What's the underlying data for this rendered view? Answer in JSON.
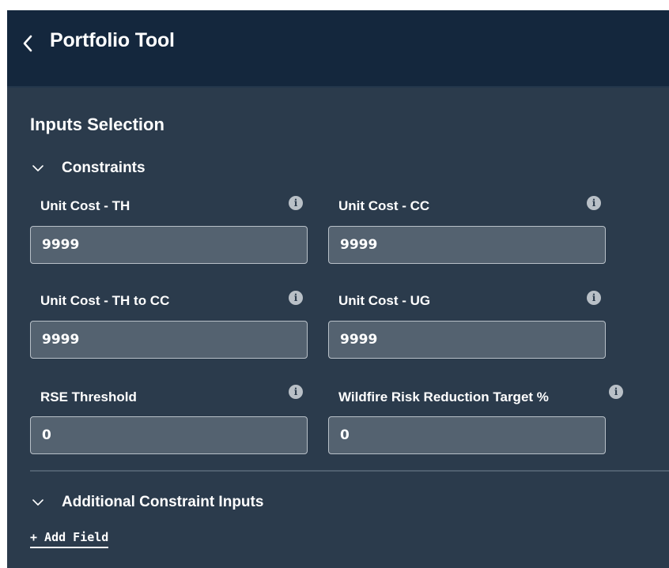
{
  "header": {
    "back_icon": "chevron-left-icon",
    "title": "Portfolio Tool"
  },
  "inputs_selection": {
    "title": "Inputs Selection"
  },
  "constraints": {
    "label": "Constraints",
    "expanded": true,
    "fields": [
      {
        "label": "Unit Cost - TH",
        "value": "9999"
      },
      {
        "label": "Unit Cost - CC",
        "value": "9999"
      },
      {
        "label": "Unit Cost - TH to CC",
        "value": "9999"
      },
      {
        "label": "Unit Cost - UG",
        "value": "9999"
      },
      {
        "label": "RSE Threshold",
        "value": "0"
      },
      {
        "label": "Wildfire Risk Reduction Target %",
        "value": "0"
      }
    ],
    "info_icon": "info-icon",
    "info_glyph": "i"
  },
  "additional": {
    "label": "Additional Constraint Inputs",
    "expanded": true,
    "add_field_label": "+ Add Field"
  },
  "colors": {
    "header_bg": "#14273d",
    "panel_bg": "#2b3b4c",
    "input_bg": "#546270",
    "input_border": "#b8c0c8",
    "info_icon": "#b9c0c7",
    "text": "#ffffff"
  }
}
